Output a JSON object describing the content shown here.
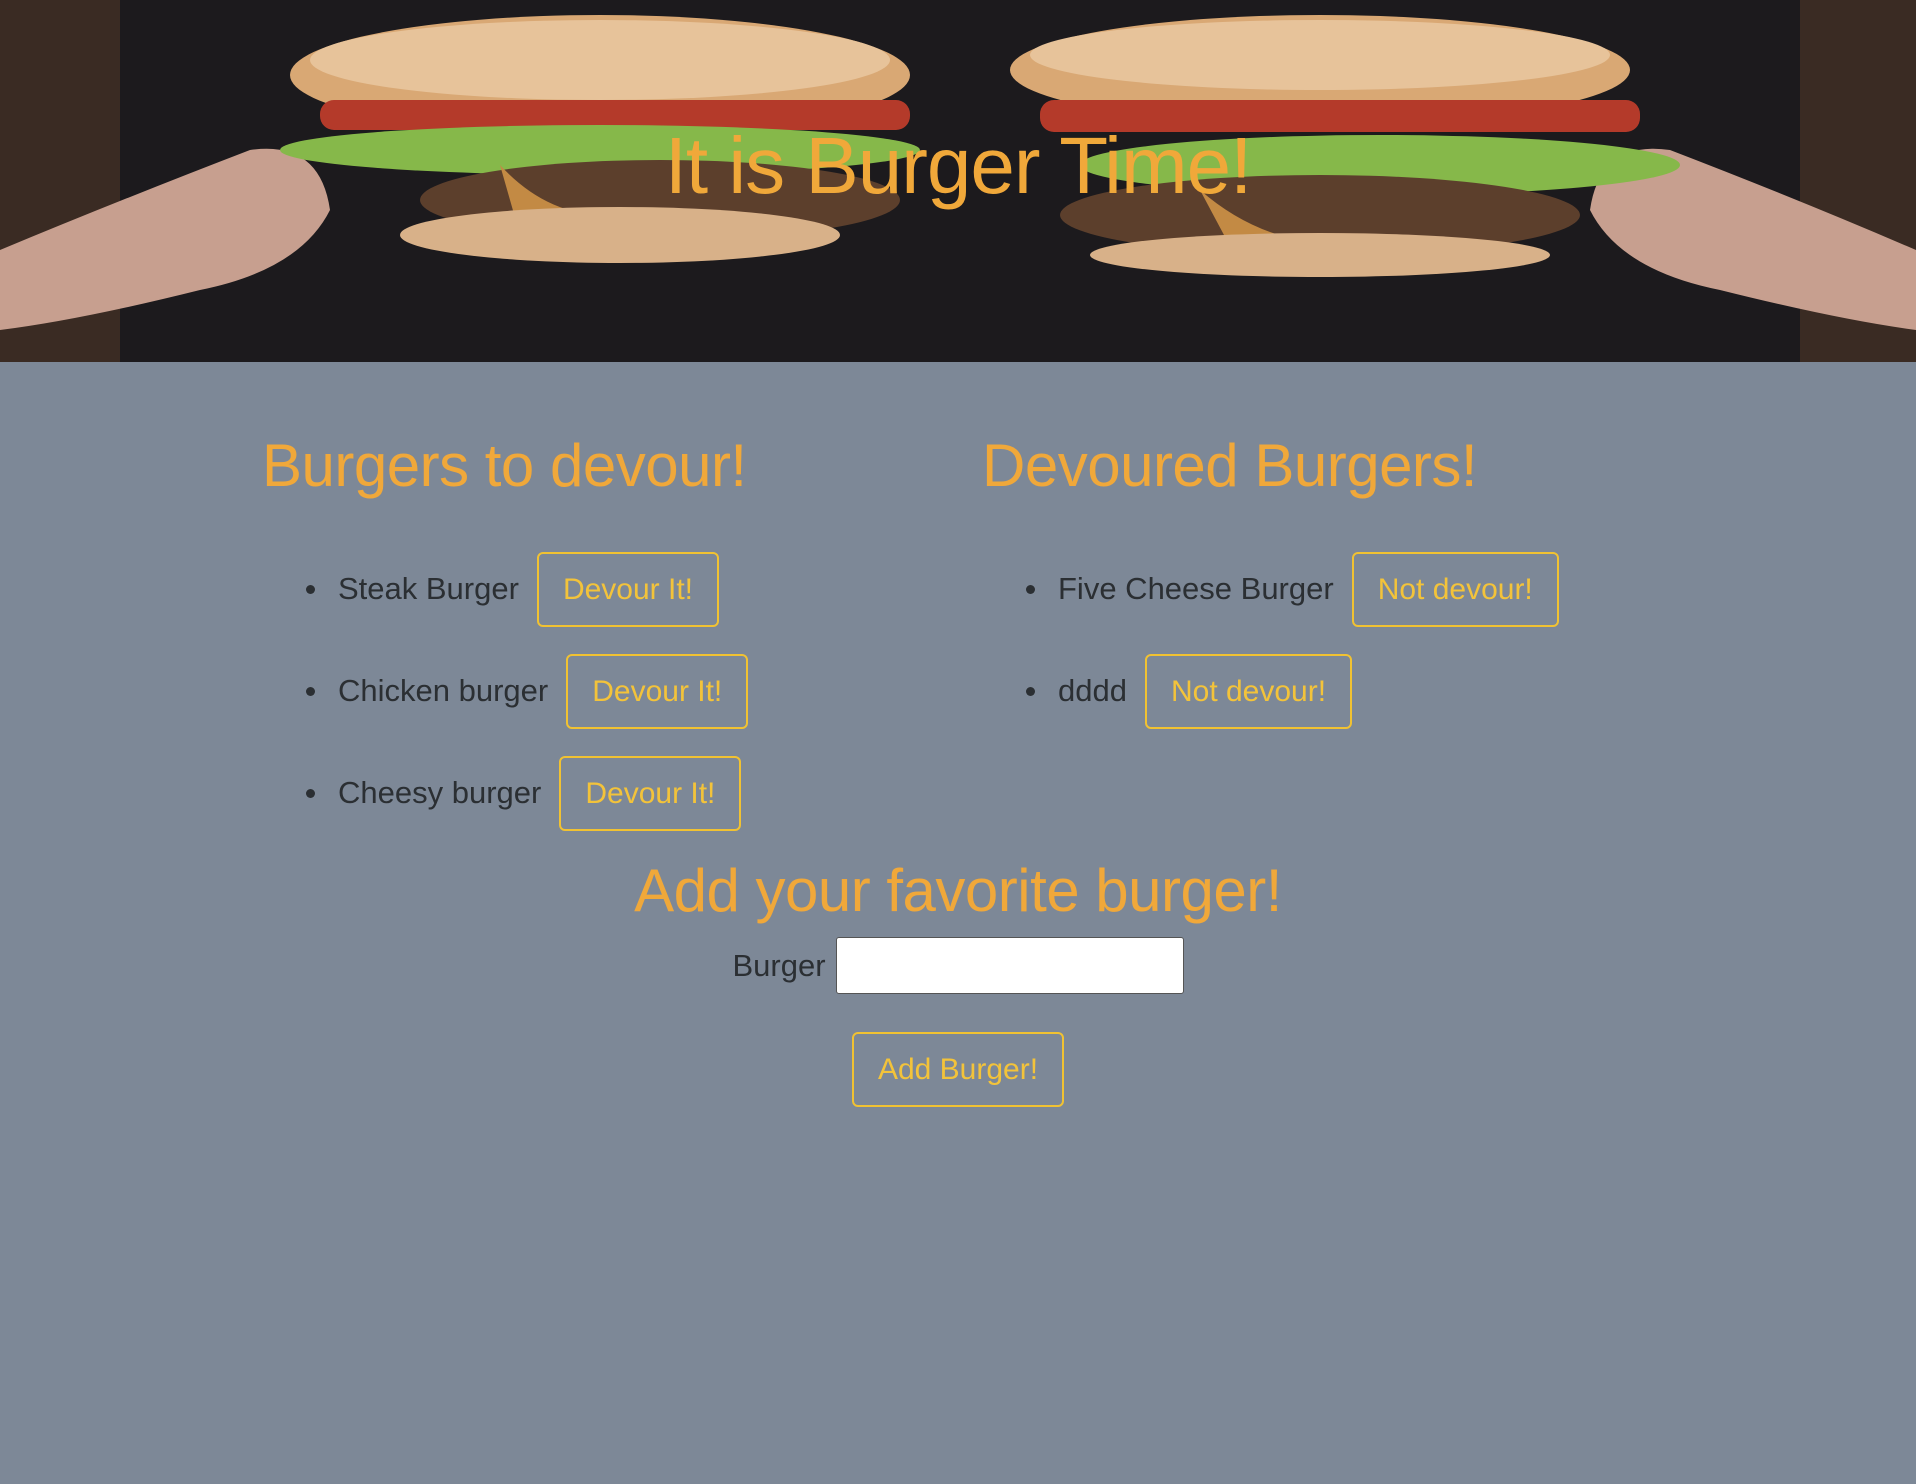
{
  "header": {
    "title": "It is Burger Time!"
  },
  "to_devour": {
    "heading": "Burgers to devour!",
    "items": [
      {
        "name": "Steak Burger",
        "button": "Devour It!"
      },
      {
        "name": "Chicken burger",
        "button": "Devour It!"
      },
      {
        "name": "Cheesy burger",
        "button": "Devour It!"
      }
    ]
  },
  "devoured": {
    "heading": "Devoured Burgers!",
    "items": [
      {
        "name": "Five Cheese Burger",
        "button": "Not devour!"
      },
      {
        "name": "dddd",
        "button": "Not devour!"
      }
    ]
  },
  "add_form": {
    "heading": "Add your favorite burger!",
    "label": "Burger",
    "input_value": "",
    "submit_label": "Add Burger!"
  },
  "colors": {
    "background": "#7d8897",
    "heading": "#f0a83a",
    "button_accent": "#f1c232",
    "text": "#2b2f33"
  }
}
